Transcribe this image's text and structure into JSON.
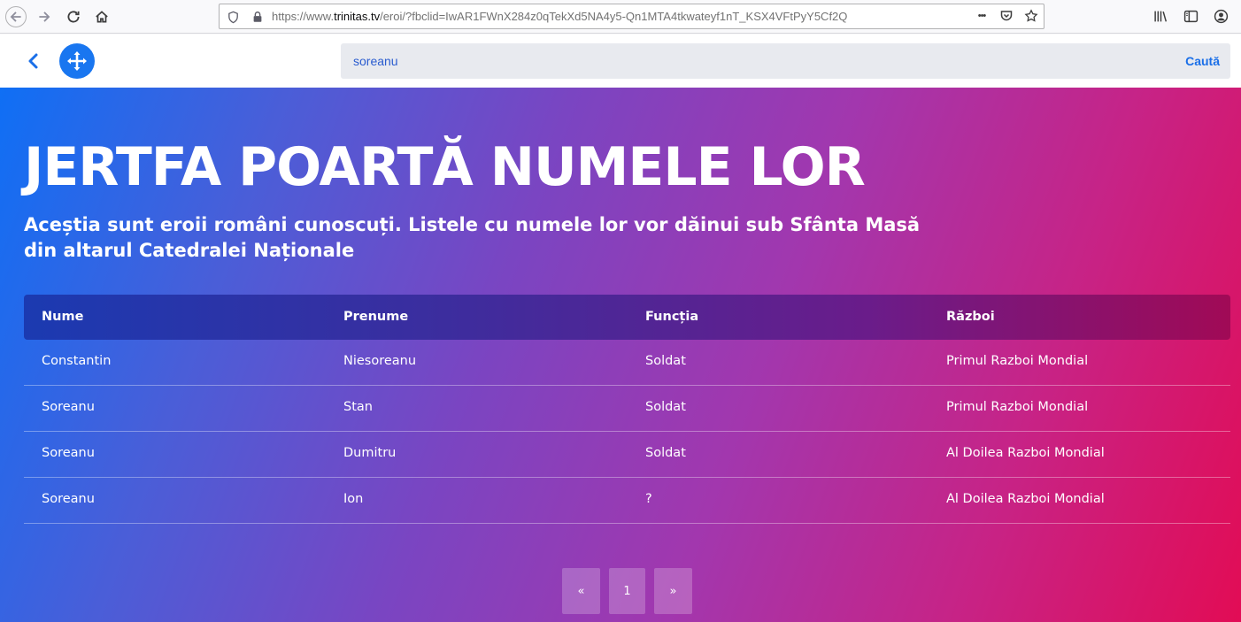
{
  "browser": {
    "url_prefix": "https://www.",
    "url_host": "trinitas.tv",
    "url_rest": "/eroi/?fbclid=IwAR1FWnX284z0qTekXd5NA4y5-Qn1MTA4tkwateyf1nT_KSX4VFtPyY5Cf2Q",
    "more_glyph": "•••"
  },
  "header": {
    "search_value": "soreanu",
    "search_button": "Caută"
  },
  "hero": {
    "title": "JERTFA POARTĂ NUMELE LOR",
    "subtitle": "Aceștia sunt eroii români cunoscuți. Listele cu numele lor vor dăinui sub Sfânta Masă din altarul Catedralei Naționale"
  },
  "table": {
    "headers": [
      "Nume",
      "Prenume",
      "Funcția",
      "Război"
    ],
    "rows": [
      [
        "Constantin",
        "Niesoreanu",
        "Soldat",
        "Primul Razboi Mondial"
      ],
      [
        "Soreanu",
        "Stan",
        "Soldat",
        "Primul Razboi Mondial"
      ],
      [
        "Soreanu",
        "Dumitru",
        "Soldat",
        "Al Doilea Razboi Mondial"
      ],
      [
        "Soreanu",
        "Ion",
        "?",
        "Al Doilea Razboi Mondial"
      ]
    ]
  },
  "pagination": {
    "prev": "«",
    "page": "1",
    "next": "»"
  },
  "colors": {
    "accent": "#1976f0",
    "gradient_start": "#0f6ff5",
    "gradient_end": "#e20c55"
  }
}
